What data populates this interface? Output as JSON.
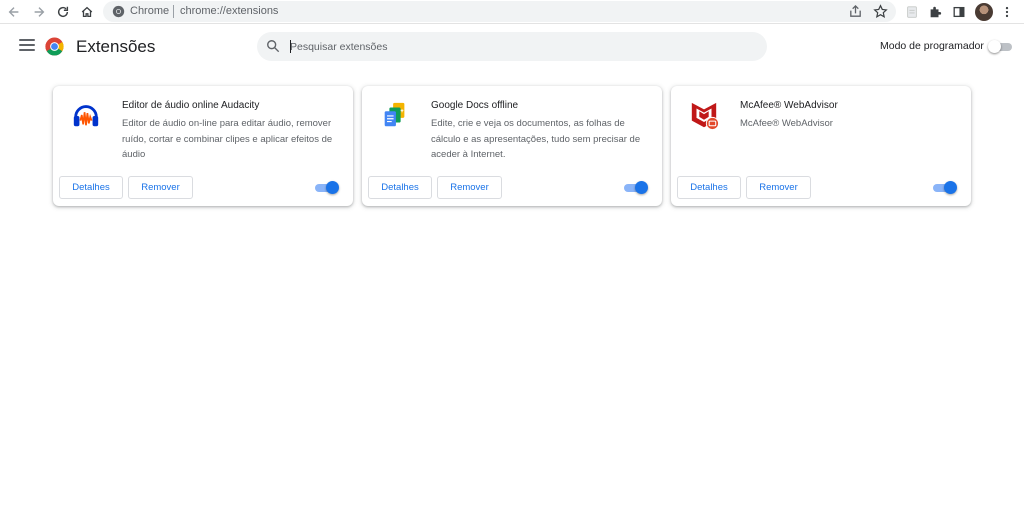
{
  "browser": {
    "site_chip": "Chrome",
    "url": "chrome://extensions"
  },
  "header": {
    "title": "Extensões",
    "search_placeholder": "Pesquisar extensões",
    "developer_mode_label": "Modo de programador",
    "developer_mode_enabled": false
  },
  "extensions": [
    {
      "name": "Editor de áudio online Audacity",
      "description": "Editor de áudio on-line para editar áudio, remover ruído, cortar e combinar clipes e aplicar efeitos de áudio",
      "details_label": "Detalhes",
      "remove_label": "Remover",
      "enabled": true,
      "icon": "audacity-icon"
    },
    {
      "name": "Google Docs offline",
      "description": "Edite, crie e veja os documentos, as folhas de cálculo e as apresentações, tudo sem precisar de aceder à Internet.",
      "details_label": "Detalhes",
      "remove_label": "Remover",
      "enabled": true,
      "icon": "google-docs-offline-icon"
    },
    {
      "name": "McAfee® WebAdvisor",
      "description": "McAfee® WebAdvisor",
      "details_label": "Detalhes",
      "remove_label": "Remover",
      "enabled": true,
      "icon": "mcafee-icon"
    }
  ],
  "colors": {
    "accent": "#1a73e8",
    "toggle_track_on": "#8ab4f8",
    "search_bg": "#f1f3f4"
  }
}
